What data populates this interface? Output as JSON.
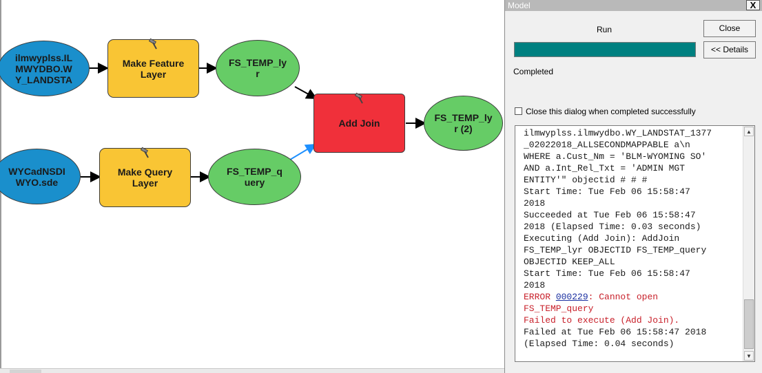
{
  "model": {
    "nodes": {
      "input_landstat": "ilmwyplss.IL\nMWYDBO.W\nY_LANDSTA",
      "make_feature_layer": "Make Feature\nLayer",
      "fs_temp_lyr": "FS_TEMP_ly\nr",
      "add_join": "Add Join",
      "fs_temp_lyr_2": "FS_TEMP_ly\nr (2)",
      "input_sde": "WYCadNSDI\nWYO.sde",
      "make_query_layer": "Make Query\nLayer",
      "fs_temp_query": "FS_TEMP_q\nuery"
    },
    "colors": {
      "data_input": "#1a8fcc",
      "tool": "#f9c534",
      "derived_data": "#66cc66",
      "failed_tool": "#f0303a",
      "highlight_connector": "#1e90ff"
    }
  },
  "dialog": {
    "title": "Model",
    "close_x": "X",
    "run_label": "Run",
    "progress_fraction": 1.0,
    "progress_color": "#008080",
    "close_label": "Close",
    "details_label": "<< Details",
    "status": "Completed",
    "auto_close_label": "Close this dialog when completed successfully",
    "auto_close_checked": false,
    "log": [
      {
        "text": "ilmwyplss.ilmwydbo.WY_LANDSTAT_1377\n_02022018_ALLSECONDMAPPABLE a\\n\nWHERE a.Cust_Nm = 'BLM-WYOMING SO'\nAND a.Int_Rel_Txt = 'ADMIN MGT\nENTITY'\" objectid # # #\nStart Time: Tue Feb 06 15:58:47\n2018\nSucceeded at Tue Feb 06 15:58:47\n2018 (Elapsed Time: 0.03 seconds)\nExecuting (Add Join): AddJoin\nFS_TEMP_lyr OBJECTID FS_TEMP_query\nOBJECTID KEEP_ALL\nStart Time: Tue Feb 06 15:58:47\n2018\n"
      },
      {
        "error_prefix": "ERROR ",
        "error_code": "000229",
        "error_text": ": Cannot open\nFS_TEMP_query\nFailed to execute (Add Join).\n"
      },
      {
        "text": "Failed at Tue Feb 06 15:58:47 2018\n(Elapsed Time: 0.04 seconds)"
      }
    ]
  }
}
